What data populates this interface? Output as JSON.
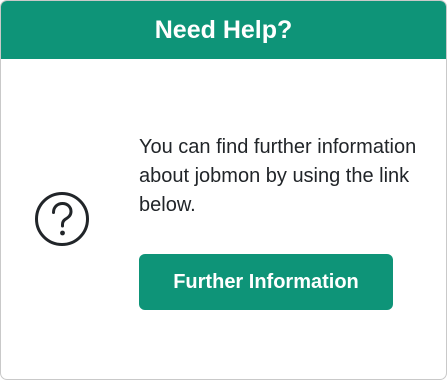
{
  "card": {
    "title": "Need Help?",
    "icon": "question-circle-icon",
    "message": "You can find further information about jobmon by using the link below.",
    "button_label": "Further Information"
  },
  "colors": {
    "accent": "#0e9478",
    "text": "#212529",
    "border": "#c9c9c9"
  }
}
